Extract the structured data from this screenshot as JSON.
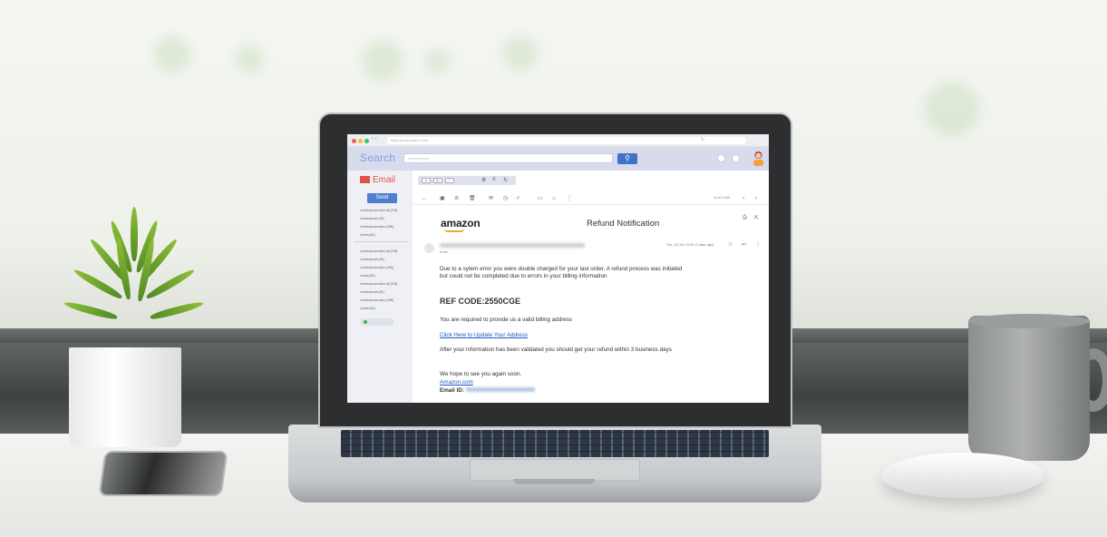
{
  "browser": {
    "url_placeholder": "https://mail.search.com"
  },
  "app": {
    "brand": "Search",
    "search_placeholder": "Lorem ipsum",
    "mail_label": "Email",
    "send_label": "Send"
  },
  "sidebar": {
    "group1": [
      "Lorem ipsum dolor sit (178)",
      "Lorem ipsum (23)",
      "Lorem ipsum dolor (196)",
      "Lorem (62)"
    ],
    "group2": [
      "Lorem ipsum dolor sit (178)",
      "Lorem ipsum (23)",
      "Lorem ipsum dolor (196)",
      "Lorem (62)",
      "Lorem ipsum dolor sit (178)",
      "Lorem ipsum (22)",
      "Lorem ipsum dolor (196)",
      "Lorem (62)"
    ]
  },
  "toolbar": {
    "pager": "14 of 1,540"
  },
  "email": {
    "logo": "amazon",
    "subject": "Refund Notification",
    "to": "to me",
    "date": "Tue, 20 Jul, 10:02 (2 days ago)",
    "para1": "Due to a sytem error you were double charged for your last order, A refund process was initiated but could not be completed due to errors in  your billing information",
    "ref_code": "REF CODE:2550CGE",
    "para2": "You are required to provide us a valid billing address",
    "link_text": "Click Here to Update Your Address",
    "para3": "After your information has been validated you should get your refund within 3 business days",
    "closing": "We hope to see you again soon.",
    "signature_link": "Amazon.com",
    "email_id_label": "Email ID:"
  }
}
